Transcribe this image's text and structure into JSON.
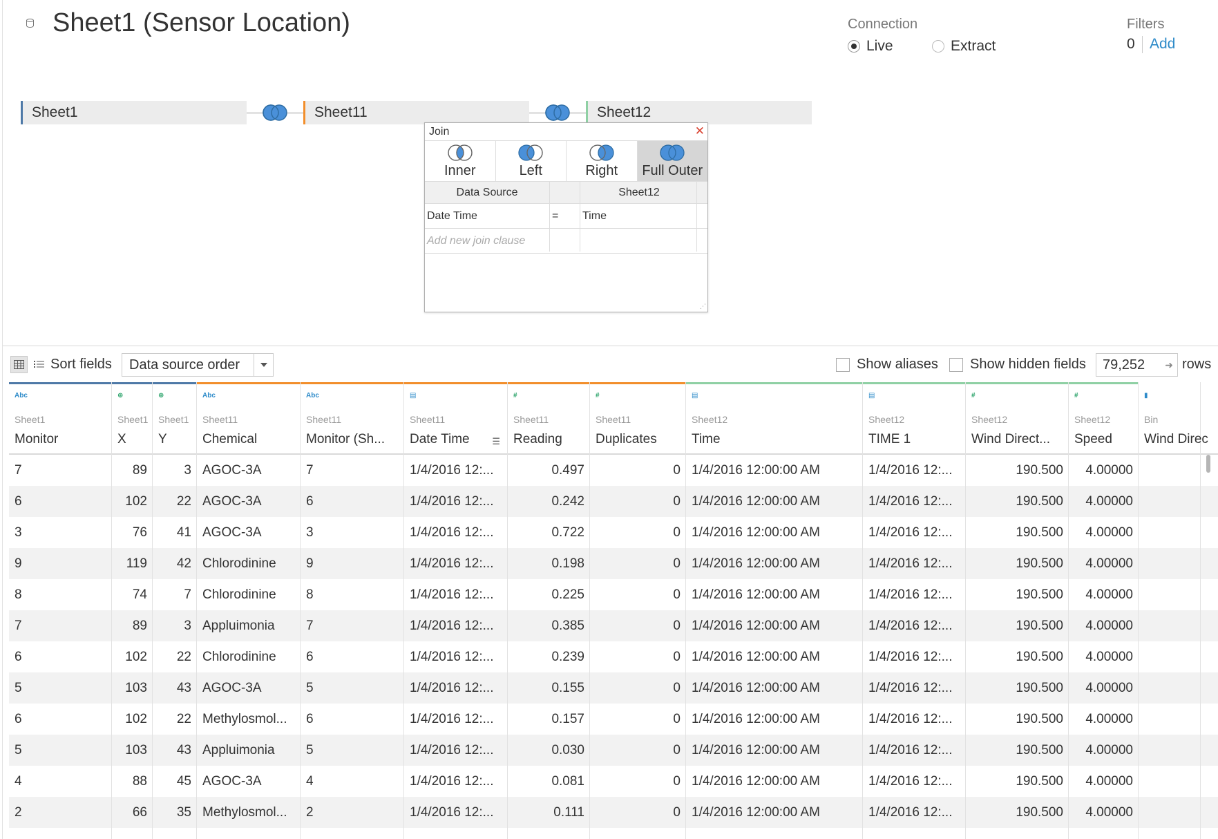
{
  "header": {
    "title": "Sheet1 (Sensor Location)",
    "connection_label": "Connection",
    "live_label": "Live",
    "extract_label": "Extract",
    "connection_selected": "Live",
    "filters_label": "Filters",
    "filters_count": "0",
    "filters_add": "Add"
  },
  "canvas": {
    "tables": [
      {
        "name": "Sheet1",
        "color": "#4e79a7"
      },
      {
        "name": "Sheet11",
        "color": "#f28e2b"
      },
      {
        "name": "Sheet12",
        "color": "#8fd0a4"
      }
    ],
    "join_icon_color": "#4a90d9"
  },
  "join_dialog": {
    "title": "Join",
    "types": [
      "Inner",
      "Left",
      "Right",
      "Full Outer"
    ],
    "selected_type": "Full Outer",
    "left_header": "Data Source",
    "right_header": "Sheet12",
    "clauses": [
      {
        "left": "Date Time",
        "op": "=",
        "right": "Time"
      }
    ],
    "add_clause_placeholder": "Add new join clause"
  },
  "toolbar": {
    "sort_label": "Sort fields",
    "sort_value": "Data source order",
    "show_aliases": "Show aliases",
    "show_hidden": "Show hidden fields",
    "rows_value": "79,252",
    "rows_label": "rows"
  },
  "grid": {
    "columns": [
      {
        "type": "Abc",
        "type_icon": "string-icon",
        "source": "Sheet1",
        "name": "Monitor",
        "color": "#4e79a7"
      },
      {
        "type": "⊕",
        "type_icon": "globe-icon",
        "source": "Sheet1",
        "name": "X",
        "color": "#4e79a7"
      },
      {
        "type": "⊕",
        "type_icon": "globe-icon",
        "source": "Sheet1",
        "name": "Y",
        "color": "#4e79a7"
      },
      {
        "type": "Abc",
        "type_icon": "string-icon",
        "source": "Sheet11",
        "name": "Chemical",
        "color": "#f28e2b"
      },
      {
        "type": "Abc",
        "type_icon": "string-icon",
        "source": "Sheet11",
        "name": "Monitor (Sh...",
        "color": "#f28e2b"
      },
      {
        "type": "▤",
        "type_icon": "datetime-icon",
        "source": "Sheet11",
        "name": "Date Time",
        "color": "#f28e2b"
      },
      {
        "type": "#",
        "type_icon": "number-icon",
        "source": "Sheet11",
        "name": "Reading",
        "color": "#f28e2b"
      },
      {
        "type": "#",
        "type_icon": "number-icon",
        "source": "Sheet11",
        "name": "Duplicates",
        "color": "#f28e2b"
      },
      {
        "type": "▤",
        "type_icon": "datetime-icon",
        "source": "Sheet12",
        "name": "Time",
        "color": "#8fd0a4"
      },
      {
        "type": "▤",
        "type_icon": "datetime-icon",
        "source": "Sheet12",
        "name": "TIME 1",
        "color": "#8fd0a4"
      },
      {
        "type": "#",
        "type_icon": "number-icon",
        "source": "Sheet12",
        "name": "Wind Direct...",
        "color": "#8fd0a4"
      },
      {
        "type": "#",
        "type_icon": "number-icon",
        "source": "Sheet12",
        "name": "Speed",
        "color": "#8fd0a4"
      },
      {
        "type": "▮",
        "type_icon": "bin-icon",
        "source": "Bin",
        "name": "Wind Direc",
        "color": "#ffffff"
      }
    ],
    "rows": [
      [
        "7",
        "89",
        "3",
        "AGOC-3A",
        "7",
        "1/4/2016 12:...",
        "0.497",
        "0",
        "1/4/2016 12:00:00 AM",
        "1/4/2016 12:...",
        "190.500",
        "4.00000",
        ""
      ],
      [
        "6",
        "102",
        "22",
        "AGOC-3A",
        "6",
        "1/4/2016 12:...",
        "0.242",
        "0",
        "1/4/2016 12:00:00 AM",
        "1/4/2016 12:...",
        "190.500",
        "4.00000",
        ""
      ],
      [
        "3",
        "76",
        "41",
        "AGOC-3A",
        "3",
        "1/4/2016 12:...",
        "0.722",
        "0",
        "1/4/2016 12:00:00 AM",
        "1/4/2016 12:...",
        "190.500",
        "4.00000",
        ""
      ],
      [
        "9",
        "119",
        "42",
        "Chlorodinine",
        "9",
        "1/4/2016 12:...",
        "0.198",
        "0",
        "1/4/2016 12:00:00 AM",
        "1/4/2016 12:...",
        "190.500",
        "4.00000",
        ""
      ],
      [
        "8",
        "74",
        "7",
        "Chlorodinine",
        "8",
        "1/4/2016 12:...",
        "0.225",
        "0",
        "1/4/2016 12:00:00 AM",
        "1/4/2016 12:...",
        "190.500",
        "4.00000",
        ""
      ],
      [
        "7",
        "89",
        "3",
        "Appluimonia",
        "7",
        "1/4/2016 12:...",
        "0.385",
        "0",
        "1/4/2016 12:00:00 AM",
        "1/4/2016 12:...",
        "190.500",
        "4.00000",
        ""
      ],
      [
        "6",
        "102",
        "22",
        "Chlorodinine",
        "6",
        "1/4/2016 12:...",
        "0.239",
        "0",
        "1/4/2016 12:00:00 AM",
        "1/4/2016 12:...",
        "190.500",
        "4.00000",
        ""
      ],
      [
        "5",
        "103",
        "43",
        "AGOC-3A",
        "5",
        "1/4/2016 12:...",
        "0.155",
        "0",
        "1/4/2016 12:00:00 AM",
        "1/4/2016 12:...",
        "190.500",
        "4.00000",
        ""
      ],
      [
        "6",
        "102",
        "22",
        "Methylosmol...",
        "6",
        "1/4/2016 12:...",
        "0.157",
        "0",
        "1/4/2016 12:00:00 AM",
        "1/4/2016 12:...",
        "190.500",
        "4.00000",
        ""
      ],
      [
        "5",
        "103",
        "43",
        "Appluimonia",
        "5",
        "1/4/2016 12:...",
        "0.030",
        "0",
        "1/4/2016 12:00:00 AM",
        "1/4/2016 12:...",
        "190.500",
        "4.00000",
        ""
      ],
      [
        "4",
        "88",
        "45",
        "AGOC-3A",
        "4",
        "1/4/2016 12:...",
        "0.081",
        "0",
        "1/4/2016 12:00:00 AM",
        "1/4/2016 12:...",
        "190.500",
        "4.00000",
        ""
      ],
      [
        "2",
        "66",
        "35",
        "Methylosmol...",
        "2",
        "1/4/2016 12:...",
        "0.111",
        "0",
        "1/4/2016 12:00:00 AM",
        "1/4/2016 12:...",
        "190.500",
        "4.00000",
        ""
      ]
    ]
  }
}
